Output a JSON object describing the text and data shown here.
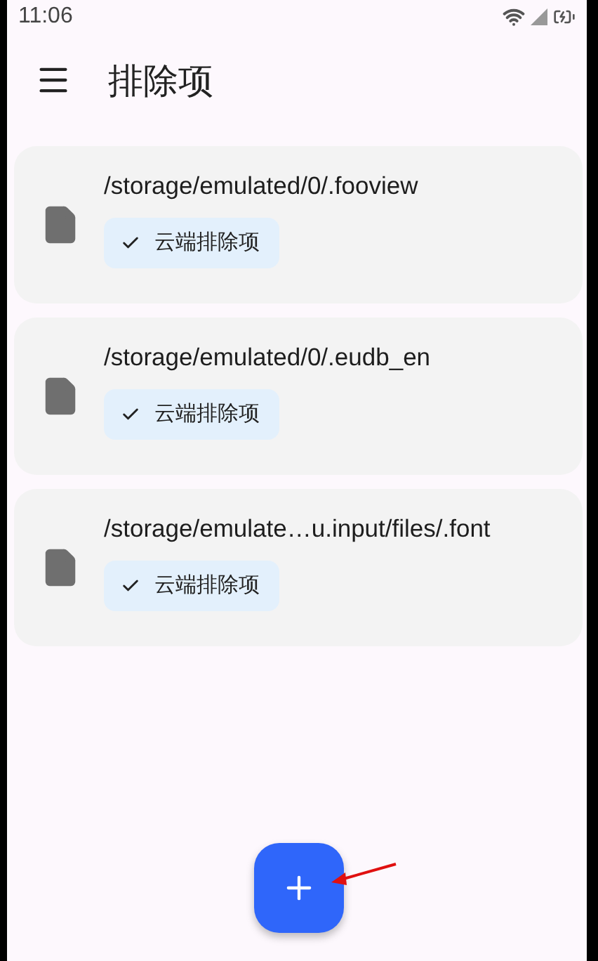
{
  "status_bar": {
    "time": "11:06"
  },
  "app_bar": {
    "title": "排除项"
  },
  "items": [
    {
      "path": "/storage/emulated/0/.fooview",
      "chip": {
        "label": "云端排除项",
        "selected": true
      }
    },
    {
      "path": "/storage/emulated/0/.eudb_en",
      "chip": {
        "label": "云端排除项",
        "selected": true
      }
    },
    {
      "path": "/storage/emulate…u.input/files/.font",
      "chip": {
        "label": "云端排除项",
        "selected": true
      }
    }
  ]
}
